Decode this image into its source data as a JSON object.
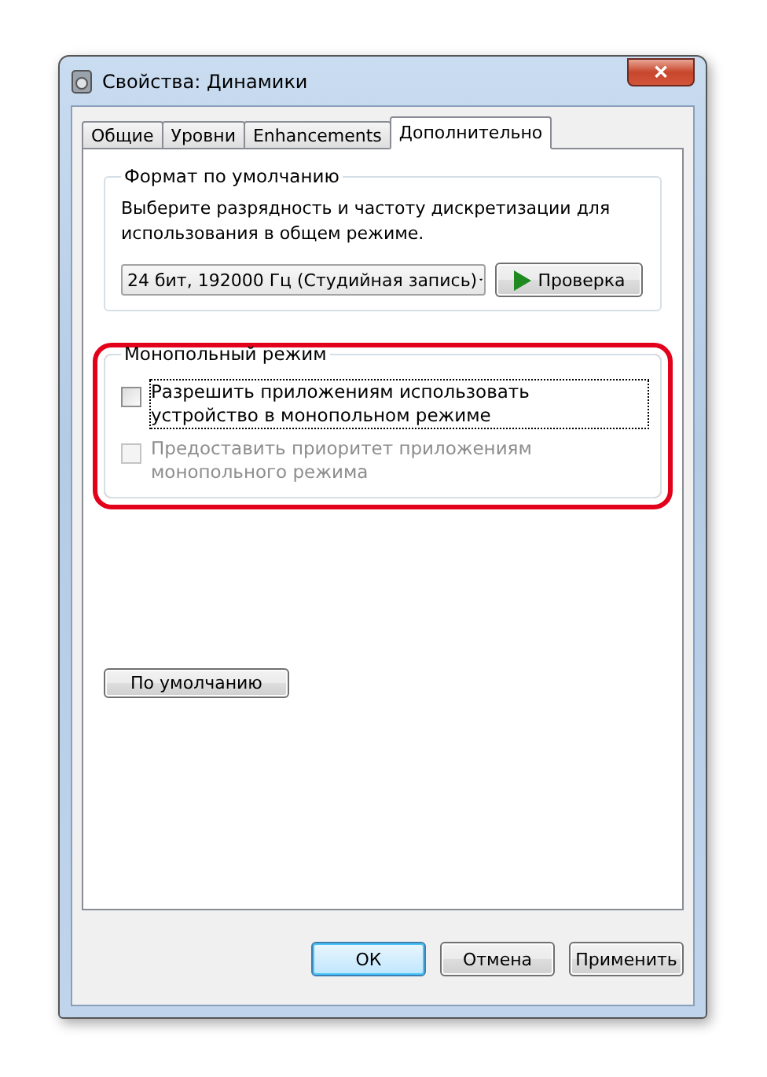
{
  "window": {
    "title": "Свойства: Динамики",
    "close": "✕"
  },
  "tabs": [
    {
      "label": "Общие",
      "selected": false
    },
    {
      "label": "Уровни",
      "selected": false
    },
    {
      "label": "Enhancements",
      "selected": false
    },
    {
      "label": "Дополнительно",
      "selected": true
    }
  ],
  "default_format": {
    "title": "Формат по умолчанию",
    "description": "Выберите разрядность и частоту дискретизации для использования в общем режиме.",
    "format_select": "24 бит, 192000 Гц (Студийная запись)",
    "test_button": "Проверка"
  },
  "exclusive_mode": {
    "title": "Монопольный режим",
    "highlighted": true,
    "options": [
      {
        "label": "Разрешить приложениям использовать устройство в монопольном режиме",
        "checked": false,
        "disabled": false,
        "focused": true
      },
      {
        "label": "Предоставить приоритет приложениям монопольного режима",
        "checked": false,
        "disabled": true,
        "focused": false
      }
    ]
  },
  "restore_button": "По умолчанию",
  "buttons": [
    {
      "label": "ОК",
      "default": true
    },
    {
      "label": "Отмена",
      "default": false
    },
    {
      "label": "Применить",
      "default": false
    }
  ]
}
